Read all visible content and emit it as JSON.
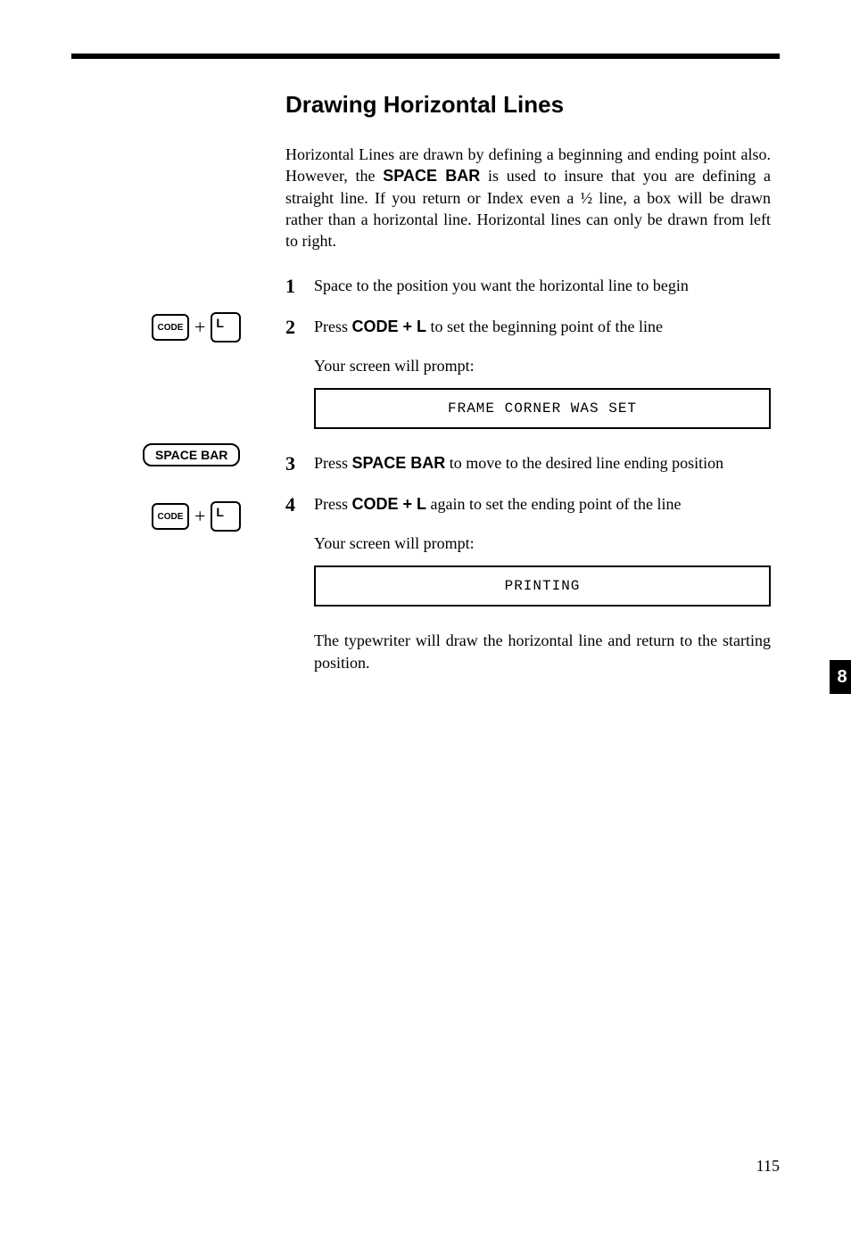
{
  "title": "Drawing Horizontal Lines",
  "intro_pre": "Horizontal Lines are drawn by defining a beginning and ending point also. However, the ",
  "intro_bold": "SPACE BAR",
  "intro_post": " is used to insure that you are defining a straight line. If you return or Index even a ½ line, a box will be drawn rather than a horizontal line. Horizontal lines can only be drawn from left to right.",
  "steps": {
    "s1": {
      "num": "1",
      "text": "Space to the position you want the horizontal line to begin"
    },
    "s2": {
      "num": "2",
      "pre": "Press ",
      "bold": "CODE + L",
      "post": " to set the beginning point of the line",
      "prompt_intro": "Your screen will prompt:",
      "prompt": "FRAME CORNER WAS SET"
    },
    "s3": {
      "num": "3",
      "pre": "Press ",
      "bold": "SPACE BAR",
      "post": " to move to the desired line ending position"
    },
    "s4": {
      "num": "4",
      "pre": "Press ",
      "bold": "CODE + L",
      "post": " again to set the ending point of the line",
      "prompt_intro": "Your screen will prompt:",
      "prompt": "PRINTING",
      "result": "The typewriter will draw the horizontal line and return to the starting position."
    }
  },
  "keys": {
    "code": "CODE",
    "l": "L",
    "spacebar": "SPACE BAR",
    "plus": "+"
  },
  "tab": "8",
  "page_number": "115"
}
